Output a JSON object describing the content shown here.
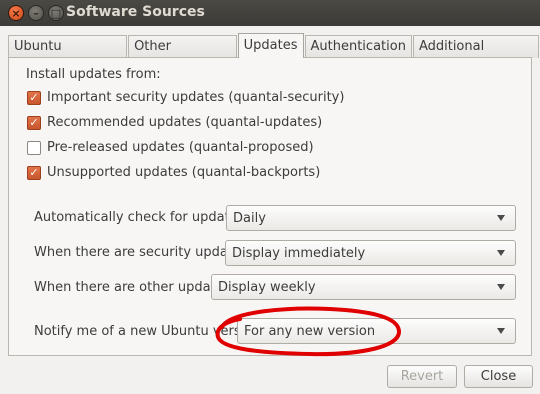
{
  "window": {
    "title": "Software Sources"
  },
  "tabs": [
    {
      "label": "Ubuntu Software"
    },
    {
      "label": "Other Software"
    },
    {
      "label": "Updates"
    },
    {
      "label": "Authentication"
    },
    {
      "label": "Additional Drivers"
    }
  ],
  "updates": {
    "install_label": "Install updates from:",
    "sources": [
      {
        "label": "Important security updates (quantal-security)",
        "checked": true
      },
      {
        "label": "Recommended updates (quantal-updates)",
        "checked": true
      },
      {
        "label": "Pre-released updates (quantal-proposed)",
        "checked": false
      },
      {
        "label": "Unsupported updates (quantal-backports)",
        "checked": true
      }
    ],
    "auto_check": {
      "label": "Automatically check for updates:",
      "value": "Daily"
    },
    "security": {
      "label": "When there are security updates:",
      "value": "Display immediately"
    },
    "other": {
      "label": "When there are other updates:",
      "value": "Display weekly"
    },
    "notify": {
      "label": "Notify me of a new Ubuntu version:",
      "value": "For any new version"
    }
  },
  "buttons": {
    "revert": "Revert",
    "close": "Close"
  },
  "colors": {
    "checkbox_accent": "#dd4814",
    "annotation": "#e00000"
  }
}
